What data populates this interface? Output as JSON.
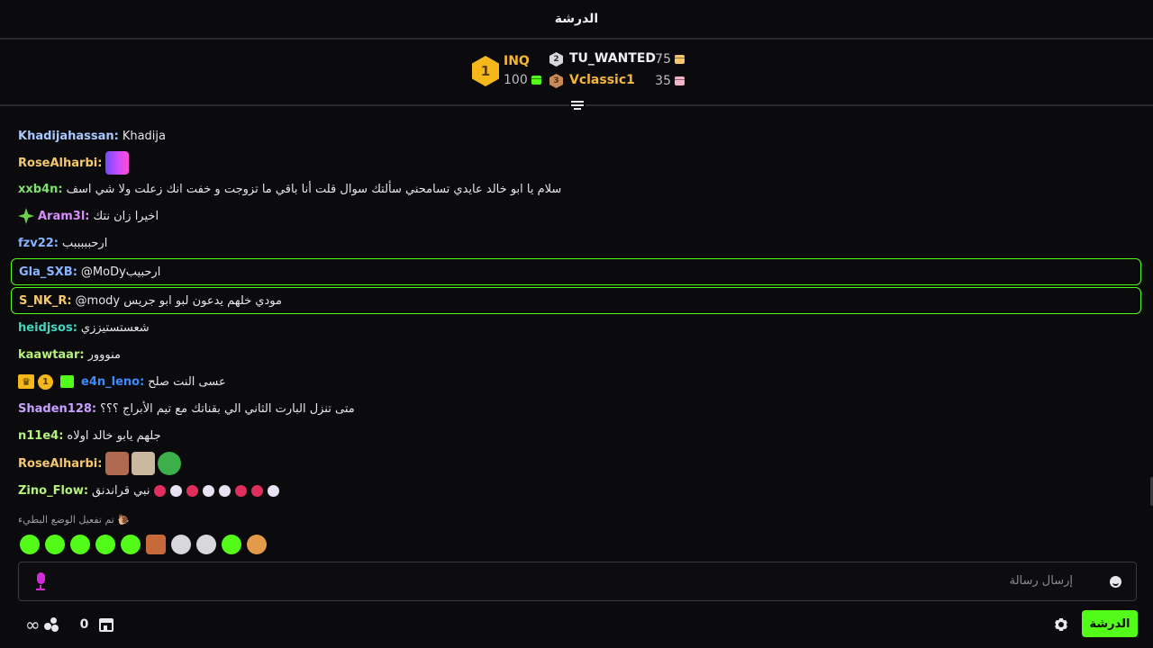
{
  "header": {
    "title": "الدرشة"
  },
  "leaderboard": {
    "first": {
      "rank": "1",
      "name": "INQ",
      "points": "100",
      "gift_color": "#53fc18"
    },
    "second": {
      "rank": "2",
      "name": "TU_WANTED",
      "points": "75",
      "name_color": "#f0f0f2"
    },
    "third": {
      "rank": "3",
      "name": "Vclassic1",
      "points": "35",
      "name_color": "#f6b53a"
    }
  },
  "messages": [
    {
      "user": "Khadijahassan:",
      "color": "#a8c8ff",
      "text": "Khadija"
    },
    {
      "user": "RoseAlharbi:",
      "color": "#f6c86a",
      "text": "",
      "emotes": [
        "equalizer-emote"
      ]
    },
    {
      "user": "xxb4n:",
      "color": "#7ee36a",
      "text": "سلام يا ابو خالد عايدي تسامحني سألتك سوال قلت أنا باقي ما تزوجت و خفت انك زعلت ولا شي اسف"
    },
    {
      "user": "Aram3l:",
      "color": "#d88cff",
      "text": "اخيرا زان نتك",
      "badges": [
        "sparkle-badge"
      ]
    },
    {
      "user": "fzv22:",
      "color": "#8ab4ff",
      "text": "ارحبببببب"
    },
    {
      "user": "Gla_SXB:",
      "color": "#8ab4ff",
      "text": "@MoDyارحبيب",
      "highlight": true
    },
    {
      "user": "S_NK_R:",
      "color": "#f6c86a",
      "text": "@mody مودي خلهم يدعون لبو ابو جريس",
      "highlight": true
    },
    {
      "user": "heidjsos:",
      "color": "#43d6c0",
      "text": "شعستستيززي"
    },
    {
      "user": "kaawtaar:",
      "color": "#b6f27a",
      "text": "منووور"
    },
    {
      "user": "e4n_leno:",
      "color": "#3b8cff",
      "text": "عسى النت صلح",
      "badges": [
        "crown-badge",
        "coin-badge",
        "gift-badge"
      ]
    },
    {
      "user": "Shaden128:",
      "color": "#c9a0ff",
      "text": "متى تنزل البارت الثاني الي بقناتك مع تيم الأبراج ؟؟؟"
    },
    {
      "user": "n11e4:",
      "color": "#b6f27a",
      "text": "جلهم يابو خالد اولاه"
    },
    {
      "user": "RoseAlharbi:",
      "color": "#f6c86a",
      "text": "",
      "emotes": [
        "face1-emote",
        "face2-emote",
        "pepe-emote"
      ]
    },
    {
      "user": "Zino_Flow:",
      "color": "#b6f27a",
      "text": "نبي قراندنق"
    }
  ],
  "system_note": "تم تفعيل الوضع البطيء",
  "emote_bar": [
    "pepe-smile-emote",
    "pepe-love-emote",
    "pepe-happy-emote",
    "pepe-money-emote",
    "pepe-sad-emote",
    "gorilla-emote",
    "pepe-clown-emote",
    "pepe-headphones-emote",
    "pepe-grin-emote",
    "pepe-gaming-emote"
  ],
  "input": {
    "placeholder": "إرسال رسالة",
    "value": ""
  },
  "footer": {
    "points": "0",
    "chat_button": "الدرشة"
  },
  "colors": {
    "accent": "#53fc18",
    "background": "#0b0b0d"
  }
}
